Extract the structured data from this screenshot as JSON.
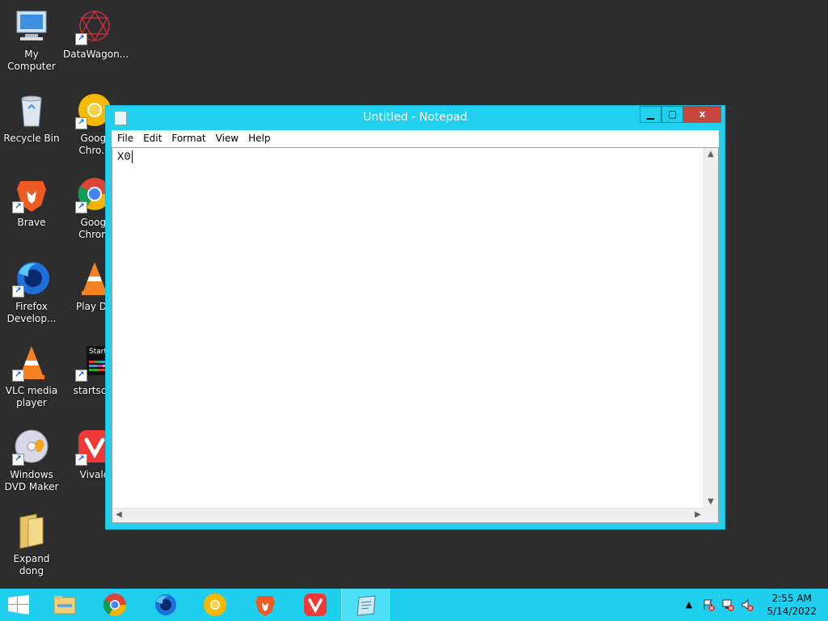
{
  "desktop": {
    "icons": [
      {
        "label": "My Computer",
        "icon": "computer-icon"
      },
      {
        "label": "DataWagon...",
        "icon": "datawagon-icon"
      },
      {
        "label": "Recycle Bin",
        "icon": "recycle-bin-icon"
      },
      {
        "label": "Googl\nChro...",
        "icon": "chrome-canary-icon"
      },
      {
        "label": "Brave",
        "icon": "brave-icon"
      },
      {
        "label": "Googl\nChrom",
        "icon": "chrome-icon"
      },
      {
        "label": "Firefox\nDevelop...",
        "icon": "firefox-dev-icon"
      },
      {
        "label": "Play DV",
        "icon": "vlc-icon"
      },
      {
        "label": "VLC media\nplayer",
        "icon": "vlc-icon"
      },
      {
        "label": "startscre",
        "icon": "startscreen-icon"
      },
      {
        "label": "Windows\nDVD Maker",
        "icon": "dvd-maker-icon"
      },
      {
        "label": "Vivald",
        "icon": "vivaldi-icon"
      },
      {
        "label": "Expand dong",
        "icon": "folder-icon"
      }
    ],
    "startscreen_thumb_text": "Start"
  },
  "notepad": {
    "title": "Untitled - Notepad",
    "menu": [
      "File",
      "Edit",
      "Format",
      "View",
      "Help"
    ],
    "content": "X0",
    "btn_minimize": "▁",
    "btn_maximize": "▢",
    "btn_close": "x"
  },
  "taskbar": {
    "items": [
      "start-button",
      "file-explorer",
      "chrome",
      "firefox-developer",
      "chrome-canary",
      "brave",
      "vivaldi",
      "notepad"
    ],
    "clock_time": "2:55 AM",
    "clock_date": "5/14/2022",
    "tray_arrow": "▲"
  },
  "colors": {
    "accent": "#20d0ee",
    "desktop": "#2d2d2d",
    "close_button": "#c8453b"
  }
}
